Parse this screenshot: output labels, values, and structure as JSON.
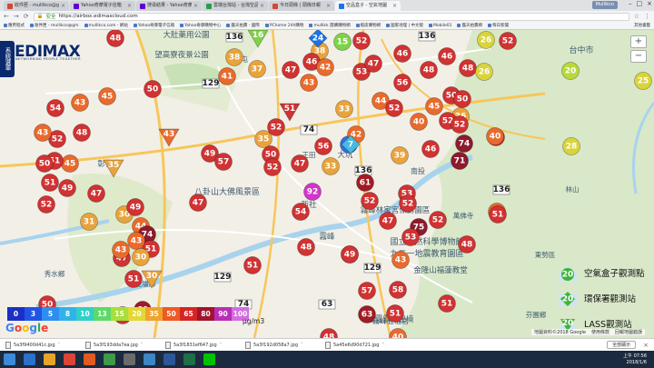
{
  "browser": {
    "tabs": [
      {
        "label": "收件匣 - mullikco@gm",
        "color": "#d44638",
        "active": false
      },
      {
        "label": "Yahoo奇摩電子信箱",
        "color": "#6001d2",
        "active": false
      },
      {
        "label": "搜尋結果 - Yahoo奇摩",
        "color": "#6001d2",
        "active": false
      },
      {
        "label": "雲端台灣站 - 台灣空品",
        "color": "#2a9d4b",
        "active": false
      },
      {
        "label": "今日頭條 | 頭條日報",
        "color": "#d44638",
        "active": false
      },
      {
        "label": "空品盒子 - 空氣地圖",
        "color": "#1a73e8",
        "active": true
      }
    ],
    "window_user": "Mullikco",
    "url": "https://airbox.edimaxcloud.com",
    "security_label": "安全",
    "bookmarks": [
      "應用程式",
      "收件匣 - mullikco@gm",
      "mullikco.com - 網站",
      "Yahoo奇摩電子信箱",
      "Yahoo奇摩購物中心",
      "露天拍賣 - 國際",
      "PChome 24h購物",
      "mullikk 團購購物網",
      "蝦皮購物網",
      "國家地理 | 中文版",
      "Mobile01",
      "露天拍賣網",
      "每日新聞"
    ],
    "other_bookmarks": "其他書籤"
  },
  "page": {
    "side_tab": "系統選單",
    "logo": "EDIMAX",
    "logo_sub": "NETWORKING PEOPLE TOGETHER",
    "zoom_in": "+",
    "zoom_out": "−"
  },
  "map": {
    "places": [
      {
        "text": "大肚藥用公園",
        "size": 8.5
      },
      {
        "text": "望高寮夜景公園",
        "size": 8.5
      },
      {
        "text": "台中市",
        "size": 9
      },
      {
        "text": "彰化市",
        "size": 8.5
      },
      {
        "text": "八卦山大佛風景區",
        "size": 9
      },
      {
        "text": "霧峰林家宮保第園區",
        "size": 8.5
      },
      {
        "text": "國立自然科學博物館",
        "size": 9
      },
      {
        "text": "九二一地震教育園區",
        "size": 9
      },
      {
        "text": "金隆山福蓮教堂",
        "size": 8.5
      },
      {
        "text": "新社",
        "size": 8.5
      },
      {
        "text": "霧峰",
        "size": 8.5
      },
      {
        "text": "芬園鄉",
        "size": 7.5
      },
      {
        "text": "秀水鄉",
        "size": 7.5
      },
      {
        "text": "花壇鄉",
        "size": 7.5
      },
      {
        "text": "南屯",
        "size": 8
      },
      {
        "text": "王田",
        "size": 7.5
      },
      {
        "text": "南投",
        "size": 8
      },
      {
        "text": "霧峰五福宮",
        "size": 8
      },
      {
        "text": "大坑",
        "size": 8.5
      },
      {
        "text": "林山",
        "size": 7.5
      },
      {
        "text": "霧霧霧路秘境",
        "size": 8.5
      },
      {
        "text": "萬佛寺",
        "size": 7.5
      },
      {
        "text": "東勢區",
        "size": 7.5
      }
    ],
    "roads": [
      "136",
      "136",
      "129",
      "74",
      "63",
      "136",
      "136",
      "129",
      "129",
      "74"
    ],
    "markers": [
      {
        "v": "48",
        "c": "#d13232"
      },
      {
        "v": "50",
        "c": "#d13232"
      },
      {
        "v": "43",
        "c": "#e96a2c"
      },
      {
        "v": "45",
        "c": "#e96a2c"
      },
      {
        "v": "54",
        "c": "#d13232"
      },
      {
        "v": "48",
        "c": "#d13232"
      },
      {
        "v": "52",
        "c": "#d13232"
      },
      {
        "v": "45",
        "c": "#e96a2c"
      },
      {
        "v": "51",
        "c": "#d13232"
      },
      {
        "v": "50",
        "c": "#d13232"
      },
      {
        "v": "51",
        "c": "#d13232"
      },
      {
        "v": "43",
        "c": "#e96a2c"
      },
      {
        "v": "38",
        "c": "#e9a33c"
      },
      {
        "v": "38",
        "c": "#e9a33c"
      },
      {
        "v": "15",
        "c": "#7ed348"
      },
      {
        "v": "52",
        "c": "#d13232"
      },
      {
        "v": "41",
        "c": "#e96a2c"
      },
      {
        "v": "37",
        "c": "#e9a33c"
      },
      {
        "v": "47",
        "c": "#d13232"
      },
      {
        "v": "46",
        "c": "#d13232"
      },
      {
        "v": "42",
        "c": "#e96a2c"
      },
      {
        "v": "43",
        "c": "#e96a2c"
      },
      {
        "v": "53",
        "c": "#d13232"
      },
      {
        "v": "47",
        "c": "#d13232"
      },
      {
        "v": "46",
        "c": "#d13232"
      },
      {
        "v": "56",
        "c": "#d13232"
      },
      {
        "v": "44",
        "c": "#e96a2c"
      },
      {
        "v": "50",
        "c": "#d13232"
      },
      {
        "v": "48",
        "c": "#d13232"
      },
      {
        "v": "46",
        "c": "#d13232"
      },
      {
        "v": "48",
        "c": "#d13232"
      },
      {
        "v": "50",
        "c": "#d13232"
      },
      {
        "v": "45",
        "c": "#e96a2c"
      },
      {
        "v": "26",
        "c": "#d9d43a"
      },
      {
        "v": "52",
        "c": "#d13232"
      },
      {
        "v": "36",
        "c": "#e9a33c"
      },
      {
        "v": "52",
        "c": "#d13232"
      },
      {
        "v": "40",
        "c": "#e96a2c"
      },
      {
        "v": "52",
        "c": "#d13232"
      },
      {
        "v": "74",
        "c": "#8c1b2d"
      },
      {
        "v": "33",
        "c": "#e9a33c"
      },
      {
        "v": "52",
        "c": "#d13232"
      },
      {
        "v": "52",
        "c": "#d13232"
      },
      {
        "v": "28",
        "c": "#d9d43a"
      },
      {
        "v": "49",
        "c": "#d13232"
      },
      {
        "v": "57",
        "c": "#d13232"
      },
      {
        "v": "35",
        "c": "#e9a33c"
      },
      {
        "v": "5",
        "c": "#2e6fe0"
      },
      {
        "v": "56",
        "c": "#d13232"
      },
      {
        "v": "33",
        "c": "#e9a33c"
      },
      {
        "v": "42",
        "c": "#e96a2c"
      },
      {
        "v": "50",
        "c": "#d13232"
      },
      {
        "v": "52",
        "c": "#d13232"
      },
      {
        "v": "47",
        "c": "#d13232"
      },
      {
        "v": "39",
        "c": "#e9a33c"
      },
      {
        "v": "71",
        "c": "#8c1b2d"
      },
      {
        "v": "46",
        "c": "#d13232"
      },
      {
        "v": "92",
        "c": "#d136c9"
      },
      {
        "v": "61",
        "c": "#a01c24"
      },
      {
        "v": "52",
        "c": "#d13232"
      },
      {
        "v": "53",
        "c": "#d13232"
      },
      {
        "v": "47",
        "c": "#d13232"
      },
      {
        "v": "52",
        "c": "#d13232"
      },
      {
        "v": "75",
        "c": "#8c1b2d"
      },
      {
        "v": "52",
        "c": "#d13232"
      },
      {
        "v": "53",
        "c": "#d13232"
      },
      {
        "v": "40",
        "c": "#e96a2c"
      },
      {
        "v": "48",
        "c": "#d13232"
      },
      {
        "v": "51",
        "c": "#d13232"
      },
      {
        "v": "43",
        "c": "#e96a2c"
      },
      {
        "v": "51",
        "c": "#d13232"
      },
      {
        "v": "54",
        "c": "#d13232"
      },
      {
        "v": "48",
        "c": "#d13232"
      },
      {
        "v": "47",
        "c": "#d13232"
      },
      {
        "v": "44",
        "c": "#e96a2c"
      },
      {
        "v": "30",
        "c": "#e9a33c"
      },
      {
        "v": "49",
        "c": "#d13232"
      },
      {
        "v": "74",
        "c": "#8c1b2d"
      },
      {
        "v": "51",
        "c": "#d13232"
      },
      {
        "v": "47",
        "c": "#d13232"
      },
      {
        "v": "43",
        "c": "#e96a2c"
      },
      {
        "v": "43",
        "c": "#e96a2c"
      },
      {
        "v": "31",
        "c": "#e9a33c"
      },
      {
        "v": "30",
        "c": "#e9a33c"
      },
      {
        "v": "51",
        "c": "#d13232"
      },
      {
        "v": "60",
        "c": "#a01c24"
      },
      {
        "v": "53",
        "c": "#d13232"
      },
      {
        "v": "51",
        "c": "#d13232"
      },
      {
        "v": "57",
        "c": "#d13232"
      },
      {
        "v": "58",
        "c": "#d13232"
      },
      {
        "v": "63",
        "c": "#a01c24"
      },
      {
        "v": "40",
        "c": "#e96a2c"
      },
      {
        "v": "48",
        "c": "#d13232"
      },
      {
        "v": "51",
        "c": "#d13232"
      },
      {
        "v": "49",
        "c": "#d13232"
      },
      {
        "v": "52",
        "c": "#d13232"
      },
      {
        "v": "47",
        "c": "#d13232"
      },
      {
        "v": "49",
        "c": "#d13232"
      },
      {
        "v": "26",
        "c": "#d9d43a"
      },
      {
        "v": "20",
        "c": "#b9d83a"
      },
      {
        "v": "25",
        "c": "#d9d43a"
      },
      {
        "v": "51",
        "c": "#d13232"
      },
      {
        "v": "40",
        "c": "#e96a2c"
      },
      {
        "v": "52",
        "c": "#d13232"
      },
      {
        "v": "50",
        "c": "#d13232"
      }
    ],
    "triangles": [
      {
        "v": "35",
        "c": "#e9a33c"
      },
      {
        "v": "43",
        "c": "#e96a2c"
      },
      {
        "v": "30",
        "c": "#e9a33c"
      },
      {
        "v": "51",
        "c": "#d13232"
      },
      {
        "v": "16",
        "c": "#7ed348"
      }
    ],
    "diamonds": [
      {
        "v": "24",
        "c": "#1a73e8"
      },
      {
        "v": "7",
        "c": "#4ab8e0"
      }
    ]
  },
  "legend": {
    "scale": [
      {
        "v": "0",
        "c": "#1a2fc5"
      },
      {
        "v": "3",
        "c": "#2154e6"
      },
      {
        "v": "5",
        "c": "#2e8ef0"
      },
      {
        "v": "8",
        "c": "#30b3e8"
      },
      {
        "v": "10",
        "c": "#2fd0c8"
      },
      {
        "v": "13",
        "c": "#5fd86a"
      },
      {
        "v": "15",
        "c": "#a6e03a"
      },
      {
        "v": "20",
        "c": "#e2d836"
      },
      {
        "v": "35",
        "c": "#f0a32c"
      },
      {
        "v": "50",
        "c": "#ee5a24"
      },
      {
        "v": "65",
        "c": "#d62424"
      },
      {
        "v": "80",
        "c": "#a0142c"
      },
      {
        "v": "90",
        "c": "#b82eb8"
      },
      {
        "v": "100",
        "c": "#d46ce0"
      }
    ],
    "unit": "μg/m3",
    "items": [
      {
        "label": "空氣盒子觀測點",
        "v": "20"
      },
      {
        "label": "環保署觀測站",
        "v": "20"
      },
      {
        "label": "LASS觀測站",
        "v": "20"
      }
    ]
  },
  "footer": {
    "google": "Google",
    "copyright": "地圖資料©2018 Google",
    "terms": "使用條款",
    "report": "回報地圖錯誤"
  },
  "downloads": {
    "items": [
      "5a3f9400d41c.jpg",
      "5a3f193dda7ea.jpg",
      "5a3f1831ef647.jpg",
      "5a3f192d058a7.jpg",
      "5a45e6d90d721.jpg"
    ],
    "show_all": "全部顯示"
  },
  "taskbar": {
    "time": "上午 07:56",
    "date": "2018/1/6"
  }
}
